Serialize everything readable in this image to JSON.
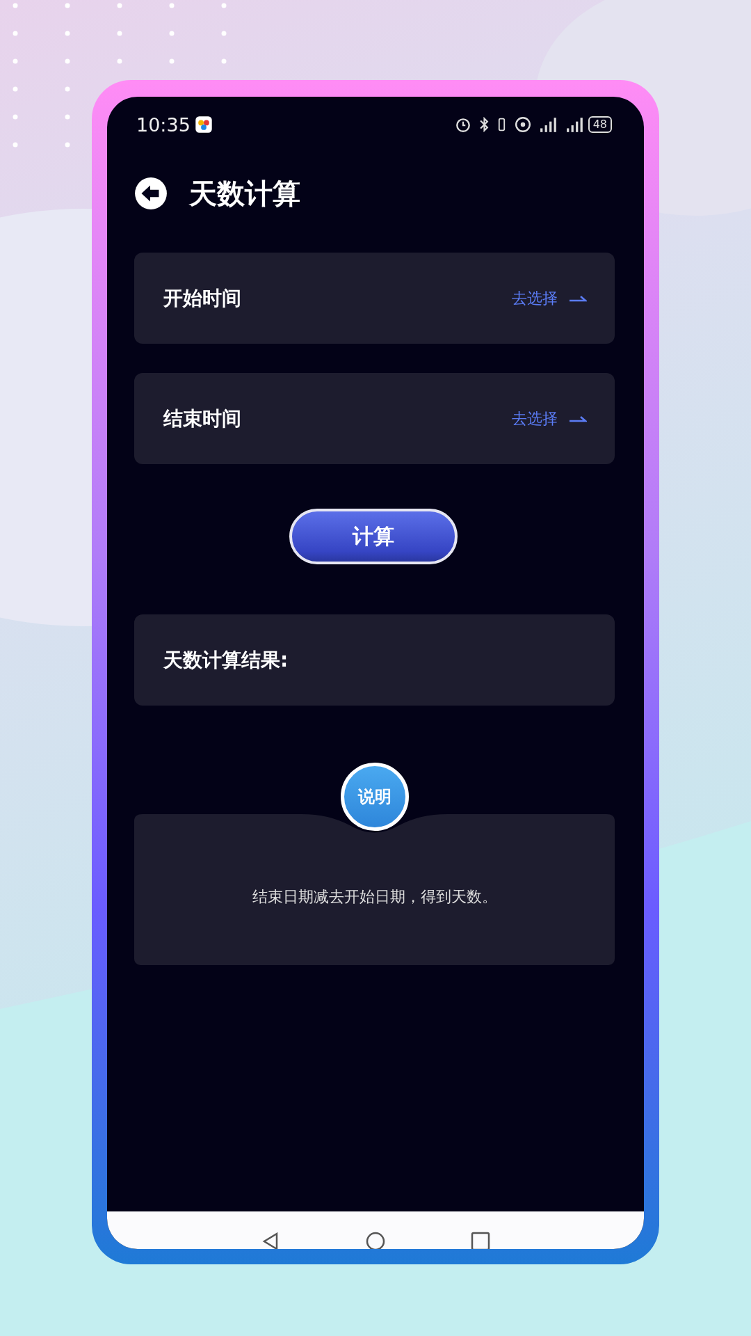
{
  "status_bar": {
    "time": "10:35",
    "battery": "48"
  },
  "header": {
    "title": "天数计算"
  },
  "fields": [
    {
      "label": "开始时间",
      "action": "去选择"
    },
    {
      "label": "结束时间",
      "action": "去选择"
    }
  ],
  "calculate_button": "计算",
  "result": {
    "label": "天数计算结果:"
  },
  "info": {
    "badge": "说明",
    "text": "结束日期减去开始日期，得到天数。"
  }
}
